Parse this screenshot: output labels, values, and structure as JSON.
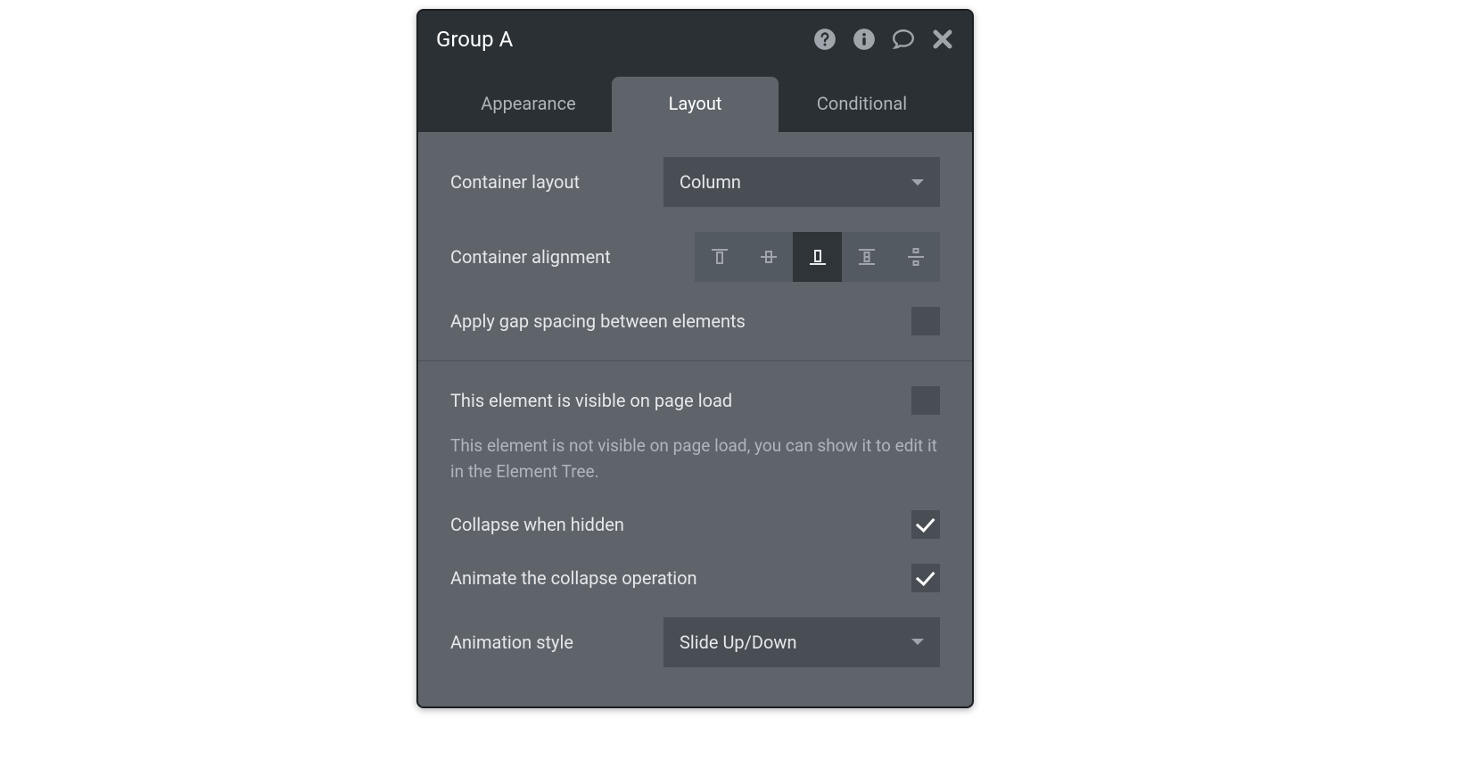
{
  "header": {
    "title": "Group A"
  },
  "tabs": {
    "appearance": "Appearance",
    "layout": "Layout",
    "conditional": "Conditional"
  },
  "layoutSection": {
    "containerLayout": {
      "label": "Container layout",
      "value": "Column"
    },
    "containerAlignment": {
      "label": "Container alignment"
    },
    "gapSpacing": {
      "label": "Apply gap spacing between elements",
      "checked": false
    }
  },
  "visibilitySection": {
    "visibleOnLoad": {
      "label": "This element is visible on page load",
      "checked": false
    },
    "helpText": "This element is not visible on page load, you can show it to edit it in the Element Tree.",
    "collapseWhenHidden": {
      "label": "Collapse when hidden",
      "checked": true
    },
    "animateCollapse": {
      "label": "Animate the collapse operation",
      "checked": true
    },
    "animationStyle": {
      "label": "Animation style",
      "value": "Slide Up/Down"
    }
  }
}
